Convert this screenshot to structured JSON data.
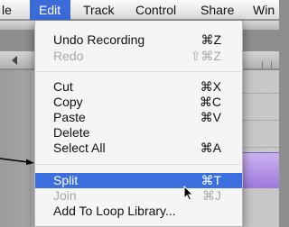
{
  "menubar": {
    "file": "le",
    "edit": "Edit",
    "track": "Track",
    "control": "Control",
    "share": "Share",
    "window": "Win"
  },
  "edit_menu": {
    "items": [
      {
        "label": "Undo Recording",
        "shortcut": "⌘Z",
        "enabled": true,
        "selected": false
      },
      {
        "label": "Redo",
        "shortcut": "⇧⌘Z",
        "enabled": false,
        "selected": false
      },
      {
        "label": "Cut",
        "shortcut": "⌘X",
        "enabled": true,
        "selected": false
      },
      {
        "label": "Copy",
        "shortcut": "⌘C",
        "enabled": true,
        "selected": false
      },
      {
        "label": "Paste",
        "shortcut": "⌘V",
        "enabled": true,
        "selected": false
      },
      {
        "label": "Delete",
        "shortcut": "",
        "enabled": true,
        "selected": false
      },
      {
        "label": "Select All",
        "shortcut": "⌘A",
        "enabled": true,
        "selected": false
      },
      {
        "label": "Split",
        "shortcut": "⌘T",
        "enabled": true,
        "selected": true
      },
      {
        "label": "Join",
        "shortcut": "⌘J",
        "enabled": false,
        "selected": false
      },
      {
        "label": "Add To Loop Library...",
        "shortcut": "",
        "enabled": true,
        "selected": false
      }
    ]
  },
  "colors": {
    "highlight": "#3b6fe0",
    "disabled_text": "#a9a9a9",
    "region": "#b395e6"
  },
  "icons": {
    "pointer_arrow": "arrow-right-line",
    "cursor": "mouse-cursor"
  }
}
